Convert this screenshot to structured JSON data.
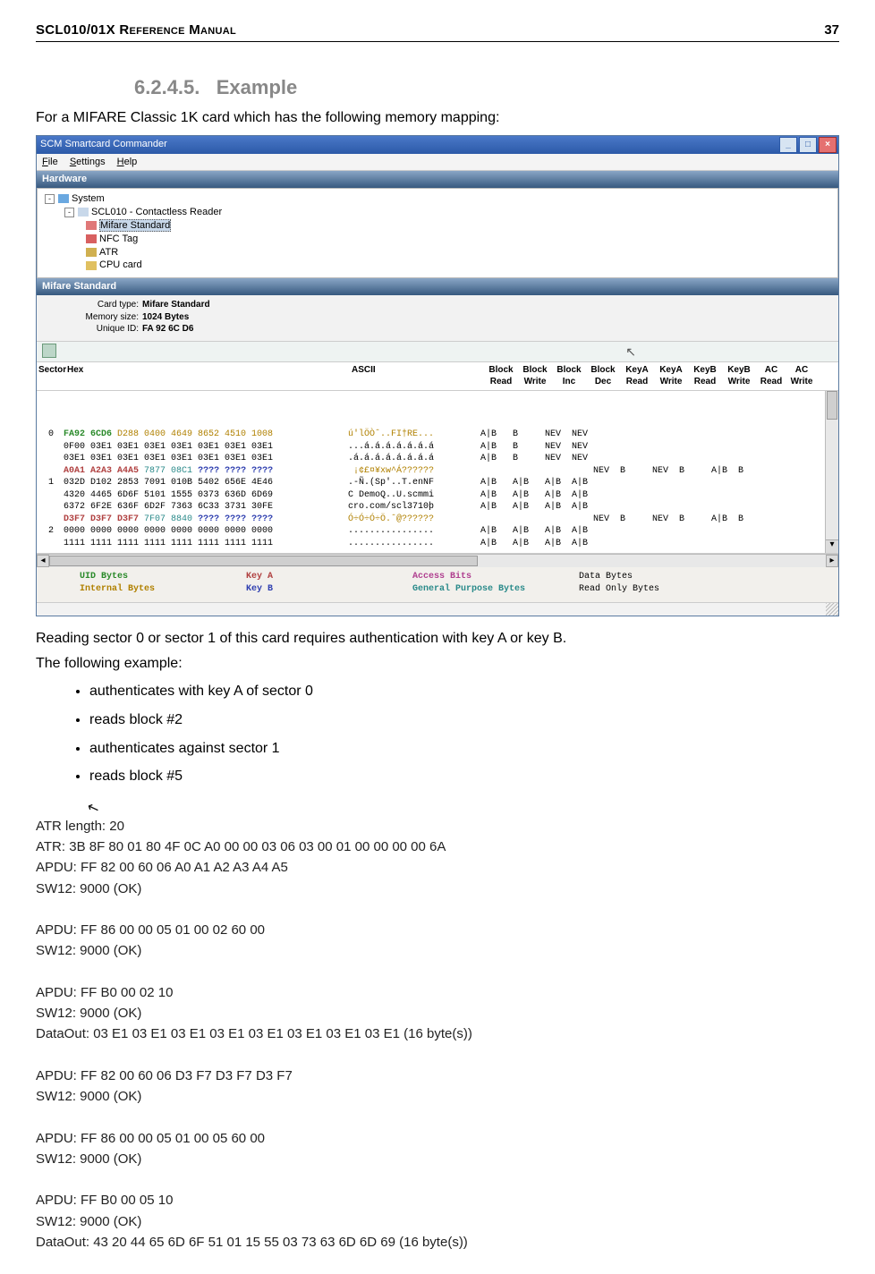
{
  "header": {
    "left": "SCL010/01X Reference Manual",
    "right": "37"
  },
  "section": {
    "num": "6.2.4.5.",
    "title": "Example"
  },
  "para1": "For a MIFARE Classic 1K card which has the following memory mapping:",
  "para2": "Reading sector 0 or sector 1 of this card requires authentication with key A or key B.",
  "para3": "The following example:",
  "bullets": [
    "authenticates with key A of sector 0",
    "reads block #2",
    "authenticates against sector 1",
    "reads block #5"
  ],
  "win": {
    "title": "SCM Smartcard Commander",
    "menu": {
      "file": "File",
      "settings": "Settings",
      "help": "Help"
    },
    "panel_hw": "Hardware",
    "tree": {
      "system": "System",
      "reader": "SCL010 - Contactless Reader",
      "mifare": "Mifare Standard",
      "nfc": "NFC Tag",
      "atr": "ATR",
      "cpu": "CPU card"
    },
    "panel_ms": "Mifare Standard",
    "info": {
      "ct_label": "Card type:",
      "ct_val": "Mifare Standard",
      "ms_label": "Memory size:",
      "ms_val": "1024 Bytes",
      "uid_label": "Unique ID:",
      "uid_val": "FA 92 6C D6"
    },
    "hexhdr": {
      "sector": "Sector",
      "hex": "Hex",
      "ascii": "ASCII",
      "br": "Block\nRead",
      "bw": "Block\nWrite",
      "bi": "Block\nInc",
      "bd": "Block\nDec",
      "kar": "KeyA\nRead",
      "kaw": "KeyA\nWrite",
      "kbr": "KeyB\nRead",
      "kbw": "KeyB\nWrite",
      "acr": "AC\nRead",
      "acw": "AC\nWrite"
    },
    "rows": [
      {
        "sec": "0",
        "hex": "FA92 6CD6 D288 0400 4649 8652 4510 1008",
        "asc": "ú'lÖÒˆ..FI†RE...",
        "perm": "A|B   B     NEV  NEV",
        "classes": [
          "c-uid",
          "",
          "",
          "",
          "",
          "",
          "",
          ""
        ]
      },
      {
        "sec": "",
        "hex": "0F00 03E1 03E1 03E1 03E1 03E1 03E1 03E1",
        "asc": "...á.á.á.á.á.á.á",
        "perm": "A|B   B     NEV  NEV"
      },
      {
        "sec": "",
        "hex": "03E1 03E1 03E1 03E1 03E1 03E1 03E1 03E1",
        "asc": ".á.á.á.á.á.á.á.á",
        "perm": "A|B   B     NEV  NEV"
      },
      {
        "sec": "",
        "hex": "A0A1 A2A3 A4A5 7877 08C1 ???? ???? ????",
        "asc": " ¡¢£¤¥xw^Á??????",
        "perm": "                     NEV  B     NEV  B     A|B  B",
        "style": "trailer"
      },
      {
        "sec": "1",
        "hex": "032D D102 2853 7091 010B 5402 656E 4E46",
        "asc": ".-Ñ.(Sp'..T.enNF",
        "perm": "A|B   A|B   A|B  A|B"
      },
      {
        "sec": "",
        "hex": "4320 4465 6D6F 5101 1555 0373 636D 6D69",
        "asc": "C DemoQ..U.scmmi",
        "perm": "A|B   A|B   A|B  A|B"
      },
      {
        "sec": "",
        "hex": "6372 6F2E 636F 6D2F 7363 6C33 3731 30FE",
        "asc": "cro.com/scl3710þ",
        "perm": "A|B   A|B   A|B  A|B"
      },
      {
        "sec": "",
        "hex": "D3F7 D3F7 D3F7 7F07 8840 ???? ???? ????",
        "asc": "Ó÷Ó÷Ó÷Ö.ˆ@??????",
        "perm": "                     NEV  B     NEV  B     A|B  B",
        "style": "trailer"
      },
      {
        "sec": "2",
        "hex": "0000 0000 0000 0000 0000 0000 0000 0000",
        "asc": "................",
        "perm": "A|B   A|B   A|B  A|B"
      },
      {
        "sec": "",
        "hex": "1111 1111 1111 1111 1111 1111 1111 1111",
        "asc": "................",
        "perm": "A|B   A|B   A|B  A|B"
      }
    ],
    "legend": {
      "uid": "UID Bytes",
      "ka": "Key A",
      "ab": "Access Bits",
      "db": "Data Bytes",
      "ib": "Internal Bytes",
      "kb": "Key B",
      "gp": "General Purpose Bytes",
      "ro": "Read Only Bytes"
    }
  },
  "log": {
    "l1": "ATR length: 20",
    "l2": "ATR: 3B 8F 80 01 80 4F 0C A0 00 00 03 06 03 00 01 00 00 00 00 6A",
    "l3": "APDU: FF 82 00 60 06 A0 A1 A2 A3 A4 A5",
    "l4": "SW12: 9000 (OK)",
    "l5": "APDU: FF 86 00 00 05 01 00 02 60 00",
    "l6": "SW12: 9000 (OK)",
    "l7": "APDU: FF B0 00 02 10",
    "l8": "SW12: 9000 (OK)",
    "l9": "DataOut: 03 E1 03 E1 03 E1 03 E1 03 E1 03 E1 03 E1 03 E1 (16 byte(s))",
    "l10": "APDU: FF 82 00 60 06 D3 F7 D3 F7 D3 F7",
    "l11": "SW12: 9000 (OK)",
    "l12": "APDU: FF 86 00 00 05 01 00 05 60 00",
    "l13": "SW12: 9000 (OK)",
    "l14": "APDU: FF B0 00 05 10",
    "l15": "SW12: 9000 (OK)",
    "l16": "DataOut: 43 20 44 65 6D 6F 51 01 15 55 03 73 63 6D 6D 69 (16 byte(s))"
  }
}
